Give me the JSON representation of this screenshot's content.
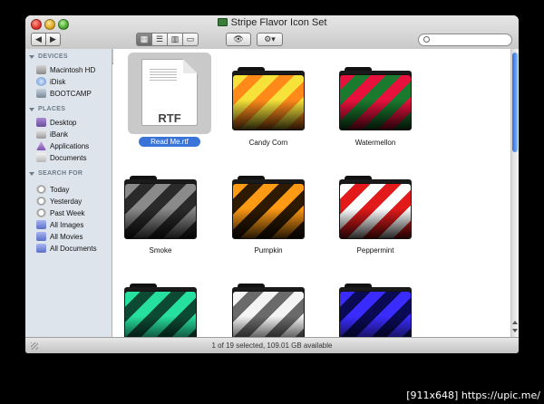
{
  "window": {
    "title": "Stripe Flavor Icon Set"
  },
  "toolbar": {
    "back_icon": "chevron-left-icon",
    "forward_icon": "chevron-right-icon",
    "view_buttons": [
      "icon-view",
      "list-view",
      "column-view",
      "coverflow-view"
    ],
    "quicklook_icon": "eye-icon",
    "action_icon": "gear-icon",
    "search_placeholder": ""
  },
  "sidebar": {
    "devices_header": "DEVICES",
    "devices": [
      {
        "label": "Macintosh HD",
        "icon": "hard-drive-icon"
      },
      {
        "label": "iDisk",
        "icon": "idisk-icon"
      },
      {
        "label": "BOOTCAMP",
        "icon": "drive-icon"
      }
    ],
    "places_header": "PLACES",
    "places": [
      {
        "label": "Desktop",
        "icon": "desktop-icon"
      },
      {
        "label": "iBank",
        "icon": "folder-icon"
      },
      {
        "label": "Applications",
        "icon": "applications-icon"
      },
      {
        "label": "Documents",
        "icon": "documents-icon"
      }
    ],
    "search_header": "SEARCH FOR",
    "search": [
      {
        "label": "Today",
        "icon": "clock-icon"
      },
      {
        "label": "Yesterday",
        "icon": "clock-icon"
      },
      {
        "label": "Past Week",
        "icon": "clock-icon"
      },
      {
        "label": "All Images",
        "icon": "smart-folder-icon"
      },
      {
        "label": "All Movies",
        "icon": "smart-folder-icon"
      },
      {
        "label": "All Documents",
        "icon": "smart-folder-icon"
      }
    ]
  },
  "files": [
    {
      "label": "Read Me.rtf",
      "kind": "document",
      "doc_text": "RTF",
      "selected": true
    },
    {
      "label": "Candy Corn",
      "kind": "folder",
      "colors": [
        "#f7e23a",
        "#ff8a1a",
        "#111111"
      ]
    },
    {
      "label": "Watermellon",
      "kind": "folder",
      "colors": [
        "#e8113d",
        "#1a7a2e",
        "#111111"
      ]
    },
    {
      "label": "Smoke",
      "kind": "folder",
      "colors": [
        "#8a8a8a",
        "#2a2a2a",
        "#111111"
      ]
    },
    {
      "label": "Pumpkin",
      "kind": "folder",
      "colors": [
        "#ff9a14",
        "#2e1a00",
        "#111111"
      ]
    },
    {
      "label": "Peppermint",
      "kind": "folder",
      "colors": [
        "#ffffff",
        "#e21a1a",
        "#111111"
      ]
    },
    {
      "label": "",
      "kind": "folder",
      "colors": [
        "#26e0a0",
        "#0c4a34",
        "#111111"
      ]
    },
    {
      "label": "",
      "kind": "folder",
      "colors": [
        "#f4f4f4",
        "#6a6a6a",
        "#111111"
      ]
    },
    {
      "label": "",
      "kind": "folder",
      "colors": [
        "#3a2cff",
        "#0a0a55",
        "#111111"
      ]
    }
  ],
  "status": {
    "text": "1 of 19 selected, 109.01 GB available"
  },
  "watermark": {
    "text": "[911x648] https://upic.me/"
  }
}
